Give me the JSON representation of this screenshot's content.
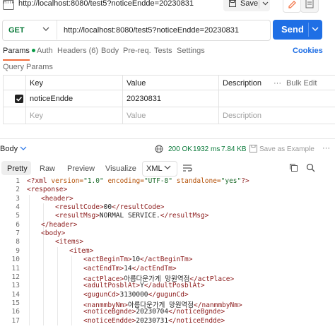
{
  "tab": {
    "badge": "HTTP",
    "title": "http://localhost:8080/test5?noticeEndde=20230831"
  },
  "toolbar": {
    "save_label": "Save"
  },
  "request": {
    "method": "GET",
    "url": "http://localhost:8080/test5?noticeEndde=20230831",
    "send_label": "Send"
  },
  "tabs": {
    "params": "Params",
    "auth": "Auth",
    "headers": "Headers (6)",
    "body": "Body",
    "prereq": "Pre-req.",
    "tests": "Tests",
    "settings": "Settings",
    "cookies": "Cookies"
  },
  "query_params": {
    "title": "Query Params",
    "headers": {
      "key": "Key",
      "value": "Value",
      "description": "Description",
      "bulk_edit": "Bulk Edit",
      "more": "···"
    },
    "rows": [
      {
        "checked": true,
        "key": "noticeEndde",
        "value": "20230831",
        "description": ""
      }
    ],
    "placeholder": {
      "key": "Key",
      "value": "Value",
      "description": "Description"
    }
  },
  "response": {
    "body_label": "Body",
    "status": "200 OK",
    "time": "1932 ms",
    "size": "7.84 KB",
    "save_example": "Save as Example",
    "more": "···",
    "views": [
      "Pretty",
      "Raw",
      "Preview",
      "Visualize"
    ],
    "format": "XML"
  },
  "code_lines": [
    {
      "n": "1",
      "indent": 0,
      "html": "<span class='t-tag'>&lt;?xml</span> <span class='t-attr'>version=</span><span class='t-val'>\"1.0\"</span> <span class='t-attr'>encoding=</span><span class='t-val'>\"UTF-8\"</span> <span class='t-attr'>standalone=</span><span class='t-val'>\"yes\"</span><span class='t-tag'>?&gt;</span>"
    },
    {
      "n": "2",
      "indent": 0,
      "html": "<span class='t-tag'>&lt;response&gt;</span>"
    },
    {
      "n": "3",
      "indent": 1,
      "html": "<span class='t-tag'>&lt;header&gt;</span>"
    },
    {
      "n": "4",
      "indent": 2,
      "html": "<span class='t-tag'>&lt;resultCode&gt;</span><span class='t-text'>00</span><span class='t-tag'>&lt;/resultCode&gt;</span>"
    },
    {
      "n": "5",
      "indent": 2,
      "html": "<span class='t-tag'>&lt;resultMsg&gt;</span><span class='t-text'>NORMAL SERVICE.</span><span class='t-tag'>&lt;/resultMsg&gt;</span>"
    },
    {
      "n": "6",
      "indent": 1,
      "html": "<span class='t-tag'>&lt;/header&gt;</span>"
    },
    {
      "n": "7",
      "indent": 1,
      "html": "<span class='t-tag'>&lt;body&gt;</span>"
    },
    {
      "n": "8",
      "indent": 2,
      "html": "<span class='t-tag'>&lt;items&gt;</span>"
    },
    {
      "n": "9",
      "indent": 3,
      "html": "<span class='t-tag'>&lt;item&gt;</span>"
    },
    {
      "n": "10",
      "indent": 4,
      "html": "<span class='t-tag'>&lt;actBeginTm&gt;</span><span class='t-text'>10</span><span class='t-tag'>&lt;/actBeginTm&gt;</span>"
    },
    {
      "n": "11",
      "indent": 4,
      "html": "<span class='t-tag'>&lt;actEndTm&gt;</span><span class='t-text'>14</span><span class='t-tag'>&lt;/actEndTm&gt;</span>"
    },
    {
      "n": "12",
      "indent": 4,
      "html": "<span class='t-tag'>&lt;actPlace&gt;</span><span class='t-text'>아름다운가게 망원역점</span><span class='t-tag'>&lt;/actPlace&gt;</span>"
    },
    {
      "n": "13",
      "indent": 4,
      "html": "<span class='t-tag'>&lt;adultPosblAt&gt;</span><span class='t-text'>Y</span><span class='t-tag'>&lt;/adultPosblAt&gt;</span>"
    },
    {
      "n": "14",
      "indent": 4,
      "html": "<span class='t-tag'>&lt;gugunCd&gt;</span><span class='t-text'>3130000</span><span class='t-tag'>&lt;/gugunCd&gt;</span>"
    },
    {
      "n": "15",
      "indent": 4,
      "html": "<span class='t-tag'>&lt;nanmmbyNm&gt;</span><span class='t-text'>아름다운가게 망원역점</span><span class='t-tag'>&lt;/nanmmbyNm&gt;</span>"
    },
    {
      "n": "16",
      "indent": 4,
      "html": "<span class='t-tag'>&lt;noticeBgnde&gt;</span><span class='t-text'>20230704</span><span class='t-tag'>&lt;/noticeBgnde&gt;</span>"
    },
    {
      "n": "17",
      "indent": 4,
      "html": "<span class='t-tag'>&lt;noticeEndde&gt;</span><span class='t-text'>20230731</span><span class='t-tag'>&lt;/noticeEndde&gt;</span>"
    }
  ],
  "colors": {
    "accent": "#1f6fe5",
    "method_get": "#0a7a3a",
    "status_ok": "#0a7a3a",
    "tab_underline": "#f26b3a"
  }
}
